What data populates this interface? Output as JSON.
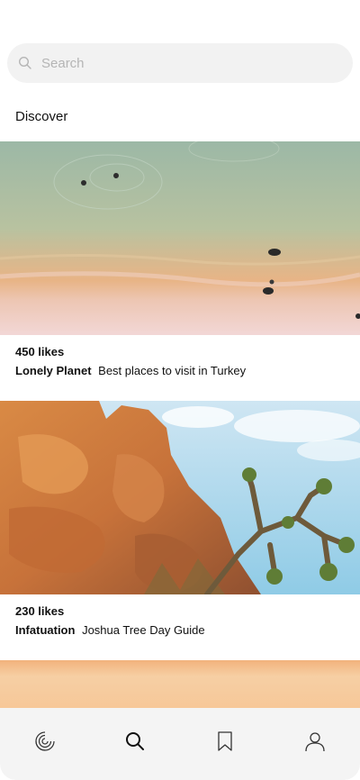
{
  "search": {
    "placeholder": "Search",
    "icon": "search-icon"
  },
  "section": {
    "title": "Discover"
  },
  "posts": [
    {
      "likes": "450 likes",
      "author": "Lonely Planet",
      "title": "Best places to visit in Turkey",
      "image": "aerial-beach-photo"
    },
    {
      "likes": "230 likes",
      "author": "Infatuation",
      "title": "Joshua Tree Day Guide",
      "image": "desert-rocks-joshua-tree-photo"
    },
    {
      "image": "sunset-sky-photo"
    }
  ],
  "tabbar": {
    "items": [
      {
        "icon": "feed-icon"
      },
      {
        "icon": "search-icon",
        "active": true
      },
      {
        "icon": "bookmark-icon"
      },
      {
        "icon": "profile-icon"
      }
    ]
  },
  "colors": {
    "search_bg": "#f2f2f2",
    "tabbar_bg": "#f4f4f4",
    "text": "#111111",
    "placeholder": "#b5b5b5"
  }
}
